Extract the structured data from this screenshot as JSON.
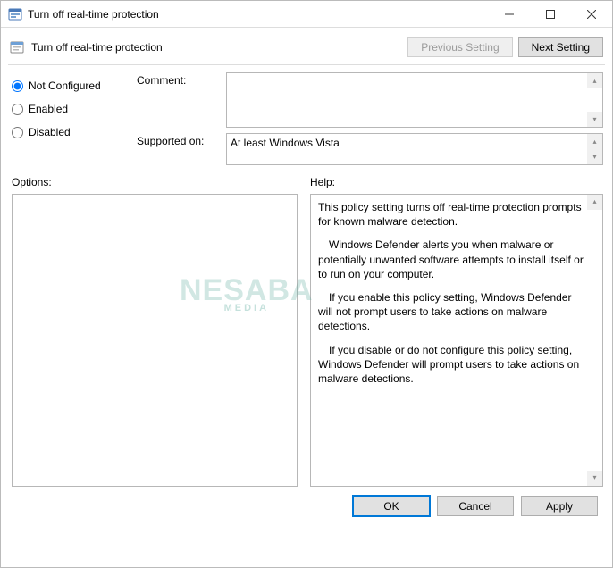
{
  "window": {
    "title": "Turn off real-time protection"
  },
  "header": {
    "title": "Turn off real-time protection",
    "prev_label": "Previous Setting",
    "next_label": "Next Setting"
  },
  "radios": {
    "not_configured": "Not Configured",
    "enabled": "Enabled",
    "disabled": "Disabled",
    "selected": "not_configured"
  },
  "labels": {
    "comment": "Comment:",
    "supported": "Supported on:",
    "options": "Options:",
    "help": "Help:"
  },
  "fields": {
    "comment_value": "",
    "supported_value": "At least Windows Vista"
  },
  "help": {
    "p1": "This policy setting turns off real-time protection prompts for known malware detection.",
    "p2": "Windows Defender alerts you when malware or potentially unwanted software attempts to install itself or to run on your computer.",
    "p3": "If you enable this policy setting, Windows Defender will not prompt users to take actions on malware detections.",
    "p4": "If you disable or do not configure this policy setting, Windows Defender will prompt users to take actions on malware detections."
  },
  "footer": {
    "ok": "OK",
    "cancel": "Cancel",
    "apply": "Apply"
  },
  "watermark": {
    "main": "NESABA",
    "sub": "MEDIA"
  }
}
